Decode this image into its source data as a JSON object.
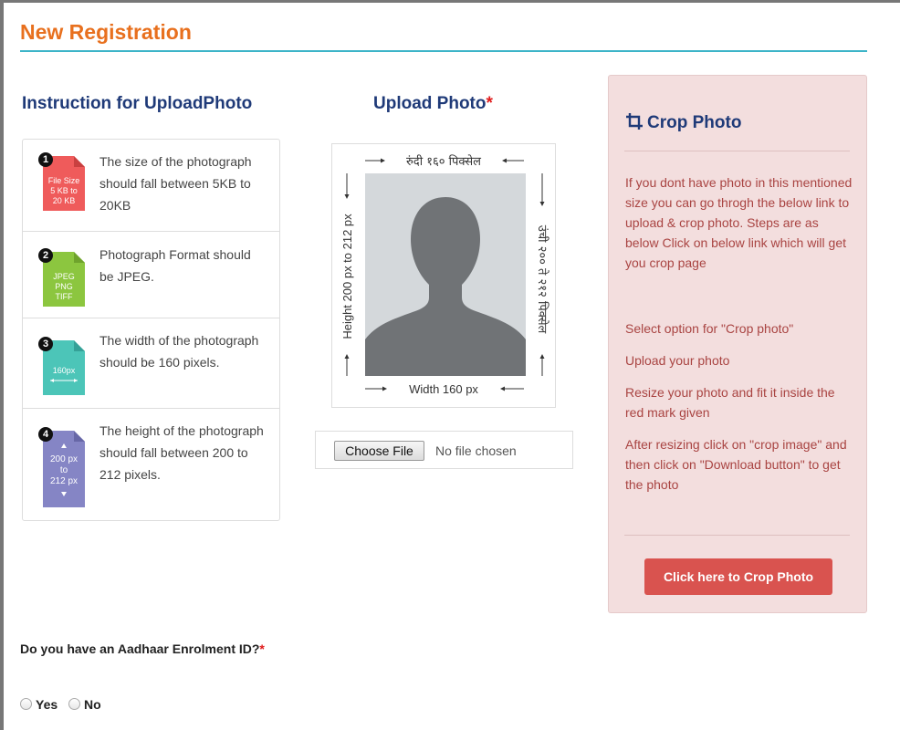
{
  "page": {
    "title": "New Registration"
  },
  "instructions": {
    "heading": "Instruction for UploadPhoto",
    "items": [
      {
        "num": "1",
        "icon": "file-size-icon",
        "icon_lines": [
          "File Size",
          "5 KB to",
          "20 KB"
        ],
        "text": "The size of the photograph should fall between 5KB to 20KB"
      },
      {
        "num": "2",
        "icon": "file-format-icon",
        "icon_lines": [
          "JPEG",
          "PNG",
          "TIFF"
        ],
        "text": "Photograph Format should be JPEG."
      },
      {
        "num": "3",
        "icon": "file-width-icon",
        "icon_lines": [
          "160px"
        ],
        "text": "The width of the photograph should be 160 pixels."
      },
      {
        "num": "4",
        "icon": "file-height-icon",
        "icon_lines": [
          "200 px",
          "to",
          "212 px"
        ],
        "text": "The height of the photograph should fall between 200 to 212 pixels."
      }
    ]
  },
  "upload": {
    "heading": "Upload Photo",
    "required_mark": "*",
    "sample": {
      "top": "रुंदी १६० पिक्सेल",
      "bottom": "Width 160 px",
      "left": "Height 200 px to 212 px",
      "right": "उंची २०० ते २१२ पिक्सेल"
    },
    "choose_label": "Choose File",
    "no_file": "No file chosen"
  },
  "crop": {
    "heading": "Crop Photo",
    "icon": "crop-icon",
    "paragraphs": [
      "If you dont have photo in this mentioned size you can go throgh the below link to upload & crop photo. Steps are as below Click on below link which will get you crop page",
      "Select option for \"Crop photo\"",
      "Upload your photo",
      "Resize your photo and fit it inside the red mark given",
      "After resizing click on \"crop image\" and then click on \"Download button\" to get the photo"
    ],
    "button_label": "Click here to Crop Photo"
  },
  "aadhaar": {
    "question": "Do you have an Aadhaar Enrolment ID?",
    "required_mark": "*",
    "options": [
      "Yes",
      "No"
    ]
  },
  "colors": {
    "title_orange": "#e8701e",
    "heading_navy": "#1f3a78",
    "crop_bg": "#f3dede",
    "crop_text": "#a94442",
    "crop_button": "#d9534f",
    "rule_teal": "#3cb4c8",
    "icon_red": "#ef5b5b",
    "icon_green": "#8cc63f",
    "icon_teal": "#4cc5b8",
    "icon_purple": "#8585c5"
  }
}
